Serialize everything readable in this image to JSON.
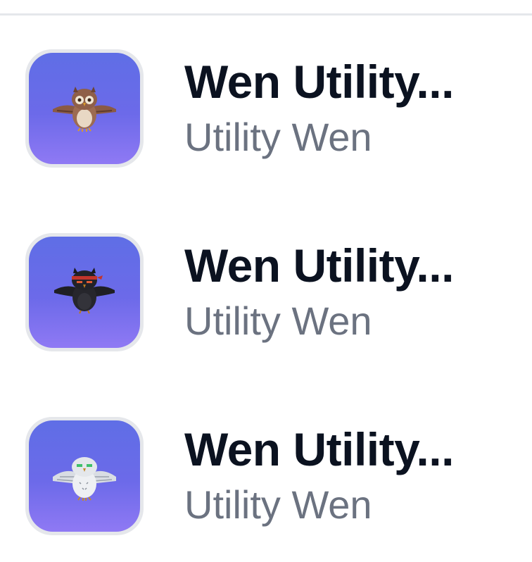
{
  "collections": [
    {
      "title": "Wen Utility...",
      "subtitle": "Utility Wen",
      "icon": "brown-owl-flying-icon"
    },
    {
      "title": "Wen Utility...",
      "subtitle": "Utility Wen",
      "icon": "black-ninja-owl-flying-icon"
    },
    {
      "title": "Wen Utility...",
      "subtitle": "Utility Wen",
      "icon": "white-owl-flying-icon"
    }
  ],
  "colors": {
    "thumb_gradient_top": "#5f6ee6",
    "thumb_gradient_bottom": "#8f79f4",
    "title_text": "#0b1220",
    "subtitle_text": "#6b7280",
    "divider": "#e5e7eb"
  }
}
